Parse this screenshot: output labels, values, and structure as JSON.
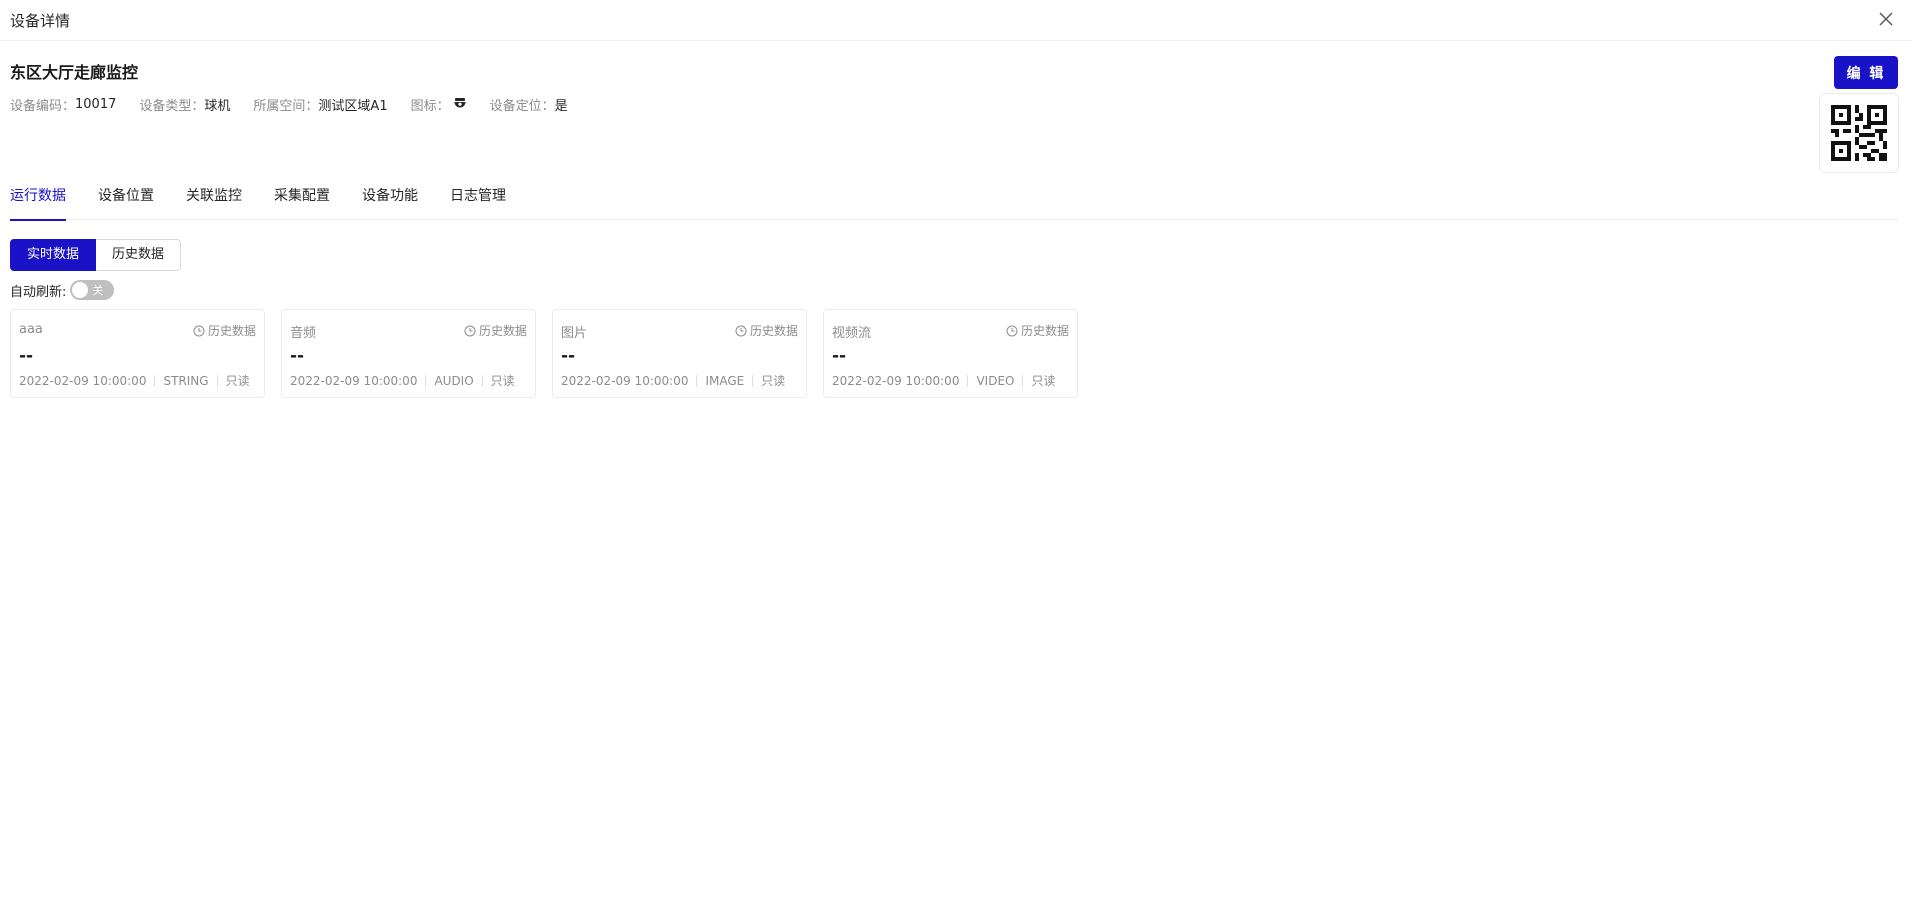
{
  "header": {
    "title": "设备详情"
  },
  "device": {
    "name": "东区大厅走廊监控",
    "meta": {
      "code_label": "设备编码：",
      "code_value": "10017",
      "type_label": "设备类型：",
      "type_value": "球机",
      "space_label": "所属空间：",
      "space_value": "测试区域A1",
      "icon_label": "图标：",
      "locate_label": "设备定位：",
      "locate_value": "是"
    }
  },
  "actions": {
    "edit_label": "编 辑"
  },
  "tabs": [
    {
      "label": "运行数据"
    },
    {
      "label": "设备位置"
    },
    {
      "label": "关联监控"
    },
    {
      "label": "采集配置"
    },
    {
      "label": "设备功能"
    },
    {
      "label": "日志管理"
    }
  ],
  "segment": {
    "realtime_label": "实时数据",
    "history_label": "历史数据"
  },
  "refresh": {
    "label": "自动刷新:",
    "toggle_text": "关"
  },
  "cards": [
    {
      "name": "aaa",
      "history_label": "历史数据",
      "value": "--",
      "time": "2022-02-09 10:00:00",
      "type": "STRING",
      "access": "只读"
    },
    {
      "name": "音频",
      "history_label": "历史数据",
      "value": "--",
      "time": "2022-02-09 10:00:00",
      "type": "AUDIO",
      "access": "只读"
    },
    {
      "name": "图片",
      "history_label": "历史数据",
      "value": "--",
      "time": "2022-02-09 10:00:00",
      "type": "IMAGE",
      "access": "只读"
    },
    {
      "name": "视频流",
      "history_label": "历史数据",
      "value": "--",
      "time": "2022-02-09 10:00:00",
      "type": "VIDEO",
      "access": "只读"
    }
  ],
  "colors": {
    "primary": "#1a12c6",
    "muted": "#8c8c8c",
    "border": "#ececec"
  }
}
